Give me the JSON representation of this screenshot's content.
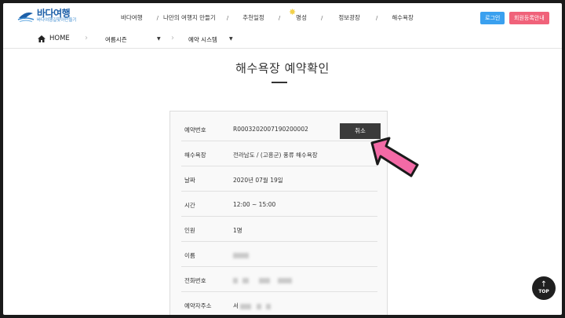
{
  "header": {
    "brand": "바다여행",
    "brand_sub": "바다여행길찾아만들기",
    "nav": [
      "바다여행",
      "나만의 여행지 만들기",
      "추천일정",
      "명성",
      "정보광장",
      "해수욕장"
    ],
    "login": "로그인",
    "register": "회원등록안내"
  },
  "subnav": {
    "home": "HOME",
    "menu1": "여름시즌",
    "menu2": "예약 시스템"
  },
  "page": {
    "title": "해수욕장 예약확인"
  },
  "reservation": {
    "rows": [
      {
        "label": "예약번호",
        "value": "R0003202007190200002"
      },
      {
        "label": "해수욕장",
        "value": "전라남도 / (고흥군) 풍류 해수욕장"
      },
      {
        "label": "날짜",
        "value": "2020년 07월 19일"
      },
      {
        "label": "시간",
        "value": "12:00 ~ 15:00"
      },
      {
        "label": "인원",
        "value": "1명"
      },
      {
        "label": "이름",
        "value": ""
      },
      {
        "label": "전화번호",
        "value": ""
      },
      {
        "label": "예약자주소",
        "value": "서"
      }
    ],
    "cancel_label": "취소"
  },
  "top_button": "TOP",
  "colors": {
    "brand": "#1c5fa8",
    "login_bg": "#3aa0ef",
    "register_bg": "#f0627a",
    "arrow": "#f36aa6"
  }
}
